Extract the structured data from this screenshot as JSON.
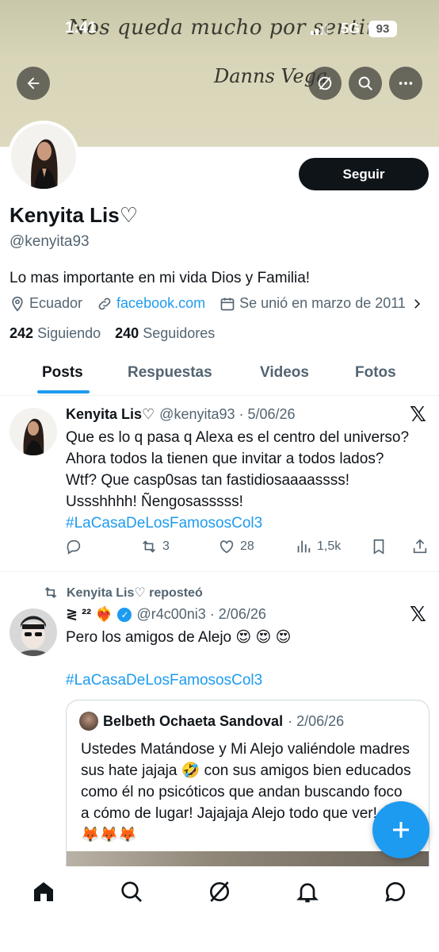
{
  "status_bar": {
    "time": "1:41",
    "network": "5G",
    "battery": "93"
  },
  "banner": {
    "quote": "Nos queda mucho por sentir.",
    "signature": "Danns Vega"
  },
  "profile": {
    "follow_label": "Seguir",
    "name": "Kenyita Lis♡",
    "handle": "@kenyita93",
    "bio": "Lo mas importante en mi vida Dios y Familia!",
    "location": "Ecuador",
    "link": "facebook.com",
    "joined": "Se unió en marzo de 2011",
    "following_count": "242",
    "following_label": "Siguiendo",
    "followers_count": "240",
    "followers_label": "Seguidores"
  },
  "tabs": [
    {
      "label": "Posts",
      "active": true
    },
    {
      "label": "Respuestas",
      "active": false
    },
    {
      "label": "Videos",
      "active": false
    },
    {
      "label": "Fotos",
      "active": false
    }
  ],
  "post1": {
    "name": "Kenyita Lis♡",
    "meta": "@kenyita93 · 5/06/26",
    "text": "Que es lo q pasa q Alexa es el centro del universo? Ahora todos la tienen que invitar a todos lados? Wtf? Que casp0sas tan fastidiosaaaassss! Ussshhhh! Ñengosasssss!",
    "hashtag": "#LaCasaDeLosFamososCol3",
    "retweets": "3",
    "likes": "28",
    "views": "1,5k"
  },
  "post2": {
    "repost_label": "Kenyita Lis♡ reposteó",
    "name": "≷ ²² ❤️‍🔥",
    "meta": "@r4c00ni3 · 2/06/26",
    "text": "Pero los amigos de Alejo 😍 😍 😍",
    "hashtag": "#LaCasaDeLosFamososCol3",
    "quote": {
      "name": "Belbeth Ochaeta Sandoval",
      "meta": "· 2/06/26",
      "text": "Ustedes Matándose y Mi Alejo valiéndole madres sus hate jajaja 🤣 con sus amigos bien educados como él no psicóticos que andan buscando foco a cómo de lugar! Jajajaja Alejo todo que ver! 🦊🦊🦊🦊"
    }
  },
  "colors": {
    "accent": "#1d9bf0",
    "text": "#0f1419",
    "muted": "#536471"
  }
}
